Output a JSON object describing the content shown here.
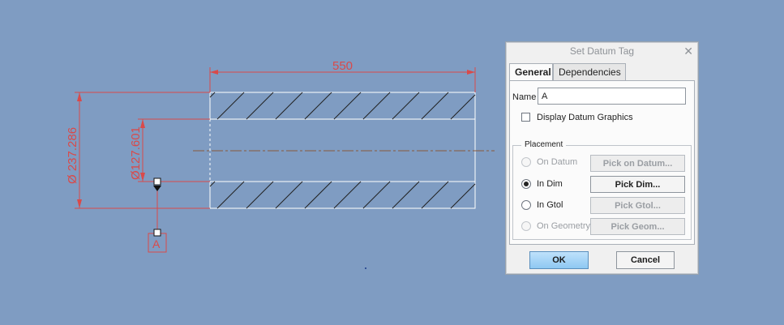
{
  "drawing": {
    "dim_length": "550",
    "dim_outer_diameter": "Ø 237.286",
    "dim_inner_diameter": "Ø127.601",
    "datum_tag_letter": "A",
    "colors": {
      "dimension": "#d94a4a",
      "geometry": "#ffffff",
      "hatch": "#202020",
      "centerline": "#8a5a3c"
    }
  },
  "dialog": {
    "title": "Set Datum Tag",
    "close_icon": "close-icon",
    "tabs": [
      {
        "label": "General",
        "active": true
      },
      {
        "label": "Dependencies",
        "active": false
      }
    ],
    "name_label": "Name",
    "name_value": "A",
    "display_datum_graphics": {
      "label": "Display Datum Graphics",
      "checked": false
    },
    "placement": {
      "title": "Placement",
      "options": [
        {
          "label": "On Datum",
          "button": "Pick on Datum...",
          "selected": false,
          "enabled": false
        },
        {
          "label": "In Dim",
          "button": "Pick Dim...",
          "selected": true,
          "enabled": true
        },
        {
          "label": "In Gtol",
          "button": "Pick Gtol...",
          "selected": false,
          "enabled": true
        },
        {
          "label": "On Geometry",
          "button": "Pick Geom...",
          "selected": false,
          "enabled": false
        }
      ]
    },
    "ok_label": "OK",
    "cancel_label": "Cancel"
  }
}
